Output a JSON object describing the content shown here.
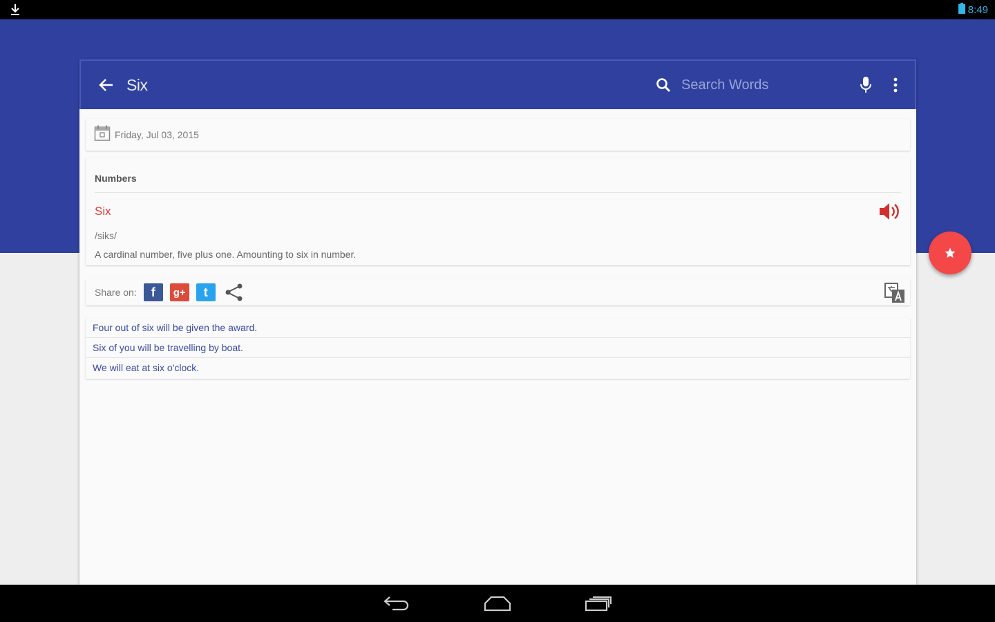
{
  "status_bar": {
    "time": "8:49"
  },
  "toolbar": {
    "title": "Six",
    "search_placeholder": "Search Words"
  },
  "date_card": {
    "date": "Friday, Jul 03, 2015"
  },
  "word_card": {
    "category": "Numbers",
    "word": "Six",
    "phonetic": "/siks/",
    "definition": "A cardinal number, five plus one. Amounting to six in number."
  },
  "share": {
    "label": "Share on:",
    "facebook_glyph": "f",
    "googleplus_glyph": "g+",
    "twitter_glyph": "t"
  },
  "examples": [
    "Four out of six will be given the award.",
    "Six of you will be travelling by boat.",
    "We will eat at six o'clock."
  ],
  "colors": {
    "primary": "#30409e",
    "accent": "#f44747",
    "word": "#e53935",
    "example_text": "#3b4aa5"
  },
  "icons": {
    "back": "arrow-left-icon",
    "search": "search-icon",
    "mic": "mic-icon",
    "menu": "more-vert-icon",
    "calendar": "calendar-icon",
    "speaker": "speaker-icon",
    "share": "share-icon",
    "translate": "translate-icon",
    "fab": "star-icon"
  }
}
